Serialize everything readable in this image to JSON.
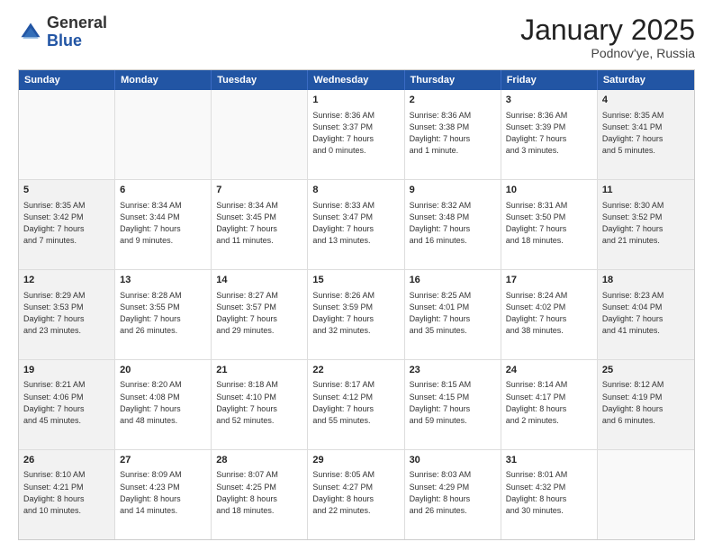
{
  "header": {
    "logo_general": "General",
    "logo_blue": "Blue",
    "month_title": "January 2025",
    "location": "Podnov'ye, Russia"
  },
  "days_of_week": [
    "Sunday",
    "Monday",
    "Tuesday",
    "Wednesday",
    "Thursday",
    "Friday",
    "Saturday"
  ],
  "weeks": [
    [
      {
        "day": "",
        "info": "",
        "empty": true
      },
      {
        "day": "",
        "info": "",
        "empty": true
      },
      {
        "day": "",
        "info": "",
        "empty": true
      },
      {
        "day": "1",
        "info": "Sunrise: 8:36 AM\nSunset: 3:37 PM\nDaylight: 7 hours\nand 0 minutes.",
        "shaded": false
      },
      {
        "day": "2",
        "info": "Sunrise: 8:36 AM\nSunset: 3:38 PM\nDaylight: 7 hours\nand 1 minute.",
        "shaded": false
      },
      {
        "day": "3",
        "info": "Sunrise: 8:36 AM\nSunset: 3:39 PM\nDaylight: 7 hours\nand 3 minutes.",
        "shaded": false
      },
      {
        "day": "4",
        "info": "Sunrise: 8:35 AM\nSunset: 3:41 PM\nDaylight: 7 hours\nand 5 minutes.",
        "shaded": true
      }
    ],
    [
      {
        "day": "5",
        "info": "Sunrise: 8:35 AM\nSunset: 3:42 PM\nDaylight: 7 hours\nand 7 minutes.",
        "shaded": true
      },
      {
        "day": "6",
        "info": "Sunrise: 8:34 AM\nSunset: 3:44 PM\nDaylight: 7 hours\nand 9 minutes.",
        "shaded": false
      },
      {
        "day": "7",
        "info": "Sunrise: 8:34 AM\nSunset: 3:45 PM\nDaylight: 7 hours\nand 11 minutes.",
        "shaded": false
      },
      {
        "day": "8",
        "info": "Sunrise: 8:33 AM\nSunset: 3:47 PM\nDaylight: 7 hours\nand 13 minutes.",
        "shaded": false
      },
      {
        "day": "9",
        "info": "Sunrise: 8:32 AM\nSunset: 3:48 PM\nDaylight: 7 hours\nand 16 minutes.",
        "shaded": false
      },
      {
        "day": "10",
        "info": "Sunrise: 8:31 AM\nSunset: 3:50 PM\nDaylight: 7 hours\nand 18 minutes.",
        "shaded": false
      },
      {
        "day": "11",
        "info": "Sunrise: 8:30 AM\nSunset: 3:52 PM\nDaylight: 7 hours\nand 21 minutes.",
        "shaded": true
      }
    ],
    [
      {
        "day": "12",
        "info": "Sunrise: 8:29 AM\nSunset: 3:53 PM\nDaylight: 7 hours\nand 23 minutes.",
        "shaded": true
      },
      {
        "day": "13",
        "info": "Sunrise: 8:28 AM\nSunset: 3:55 PM\nDaylight: 7 hours\nand 26 minutes.",
        "shaded": false
      },
      {
        "day": "14",
        "info": "Sunrise: 8:27 AM\nSunset: 3:57 PM\nDaylight: 7 hours\nand 29 minutes.",
        "shaded": false
      },
      {
        "day": "15",
        "info": "Sunrise: 8:26 AM\nSunset: 3:59 PM\nDaylight: 7 hours\nand 32 minutes.",
        "shaded": false
      },
      {
        "day": "16",
        "info": "Sunrise: 8:25 AM\nSunset: 4:01 PM\nDaylight: 7 hours\nand 35 minutes.",
        "shaded": false
      },
      {
        "day": "17",
        "info": "Sunrise: 8:24 AM\nSunset: 4:02 PM\nDaylight: 7 hours\nand 38 minutes.",
        "shaded": false
      },
      {
        "day": "18",
        "info": "Sunrise: 8:23 AM\nSunset: 4:04 PM\nDaylight: 7 hours\nand 41 minutes.",
        "shaded": true
      }
    ],
    [
      {
        "day": "19",
        "info": "Sunrise: 8:21 AM\nSunset: 4:06 PM\nDaylight: 7 hours\nand 45 minutes.",
        "shaded": true
      },
      {
        "day": "20",
        "info": "Sunrise: 8:20 AM\nSunset: 4:08 PM\nDaylight: 7 hours\nand 48 minutes.",
        "shaded": false
      },
      {
        "day": "21",
        "info": "Sunrise: 8:18 AM\nSunset: 4:10 PM\nDaylight: 7 hours\nand 52 minutes.",
        "shaded": false
      },
      {
        "day": "22",
        "info": "Sunrise: 8:17 AM\nSunset: 4:12 PM\nDaylight: 7 hours\nand 55 minutes.",
        "shaded": false
      },
      {
        "day": "23",
        "info": "Sunrise: 8:15 AM\nSunset: 4:15 PM\nDaylight: 7 hours\nand 59 minutes.",
        "shaded": false
      },
      {
        "day": "24",
        "info": "Sunrise: 8:14 AM\nSunset: 4:17 PM\nDaylight: 8 hours\nand 2 minutes.",
        "shaded": false
      },
      {
        "day": "25",
        "info": "Sunrise: 8:12 AM\nSunset: 4:19 PM\nDaylight: 8 hours\nand 6 minutes.",
        "shaded": true
      }
    ],
    [
      {
        "day": "26",
        "info": "Sunrise: 8:10 AM\nSunset: 4:21 PM\nDaylight: 8 hours\nand 10 minutes.",
        "shaded": true
      },
      {
        "day": "27",
        "info": "Sunrise: 8:09 AM\nSunset: 4:23 PM\nDaylight: 8 hours\nand 14 minutes.",
        "shaded": false
      },
      {
        "day": "28",
        "info": "Sunrise: 8:07 AM\nSunset: 4:25 PM\nDaylight: 8 hours\nand 18 minutes.",
        "shaded": false
      },
      {
        "day": "29",
        "info": "Sunrise: 8:05 AM\nSunset: 4:27 PM\nDaylight: 8 hours\nand 22 minutes.",
        "shaded": false
      },
      {
        "day": "30",
        "info": "Sunrise: 8:03 AM\nSunset: 4:29 PM\nDaylight: 8 hours\nand 26 minutes.",
        "shaded": false
      },
      {
        "day": "31",
        "info": "Sunrise: 8:01 AM\nSunset: 4:32 PM\nDaylight: 8 hours\nand 30 minutes.",
        "shaded": false
      },
      {
        "day": "",
        "info": "",
        "empty": true,
        "shaded": true
      }
    ]
  ]
}
